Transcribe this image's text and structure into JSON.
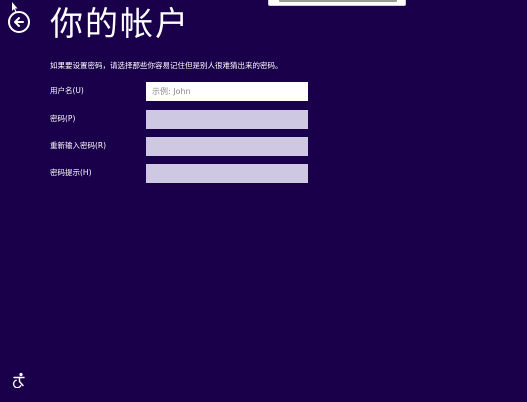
{
  "header": {
    "title": "你的帐户",
    "back_icon": "back-arrow-icon"
  },
  "form": {
    "instruction": "如果要设置密码，请选择那些你容易记住但是别人很难猜出来的密码。",
    "username": {
      "label": "用户名(U)",
      "value": "",
      "placeholder": "示例: John"
    },
    "password": {
      "label": "密码(P)",
      "value": ""
    },
    "password_confirm": {
      "label": "重新输入密码(R)",
      "value": ""
    },
    "password_hint": {
      "label": "密码提示(H)",
      "value": ""
    }
  },
  "footer": {
    "ease_of_access_icon": "ease-of-access-icon"
  },
  "colors": {
    "background": "#1a004a",
    "input_active": "#ffffff",
    "input_inactive": "#cfc8e2",
    "text": "#ffffff"
  }
}
